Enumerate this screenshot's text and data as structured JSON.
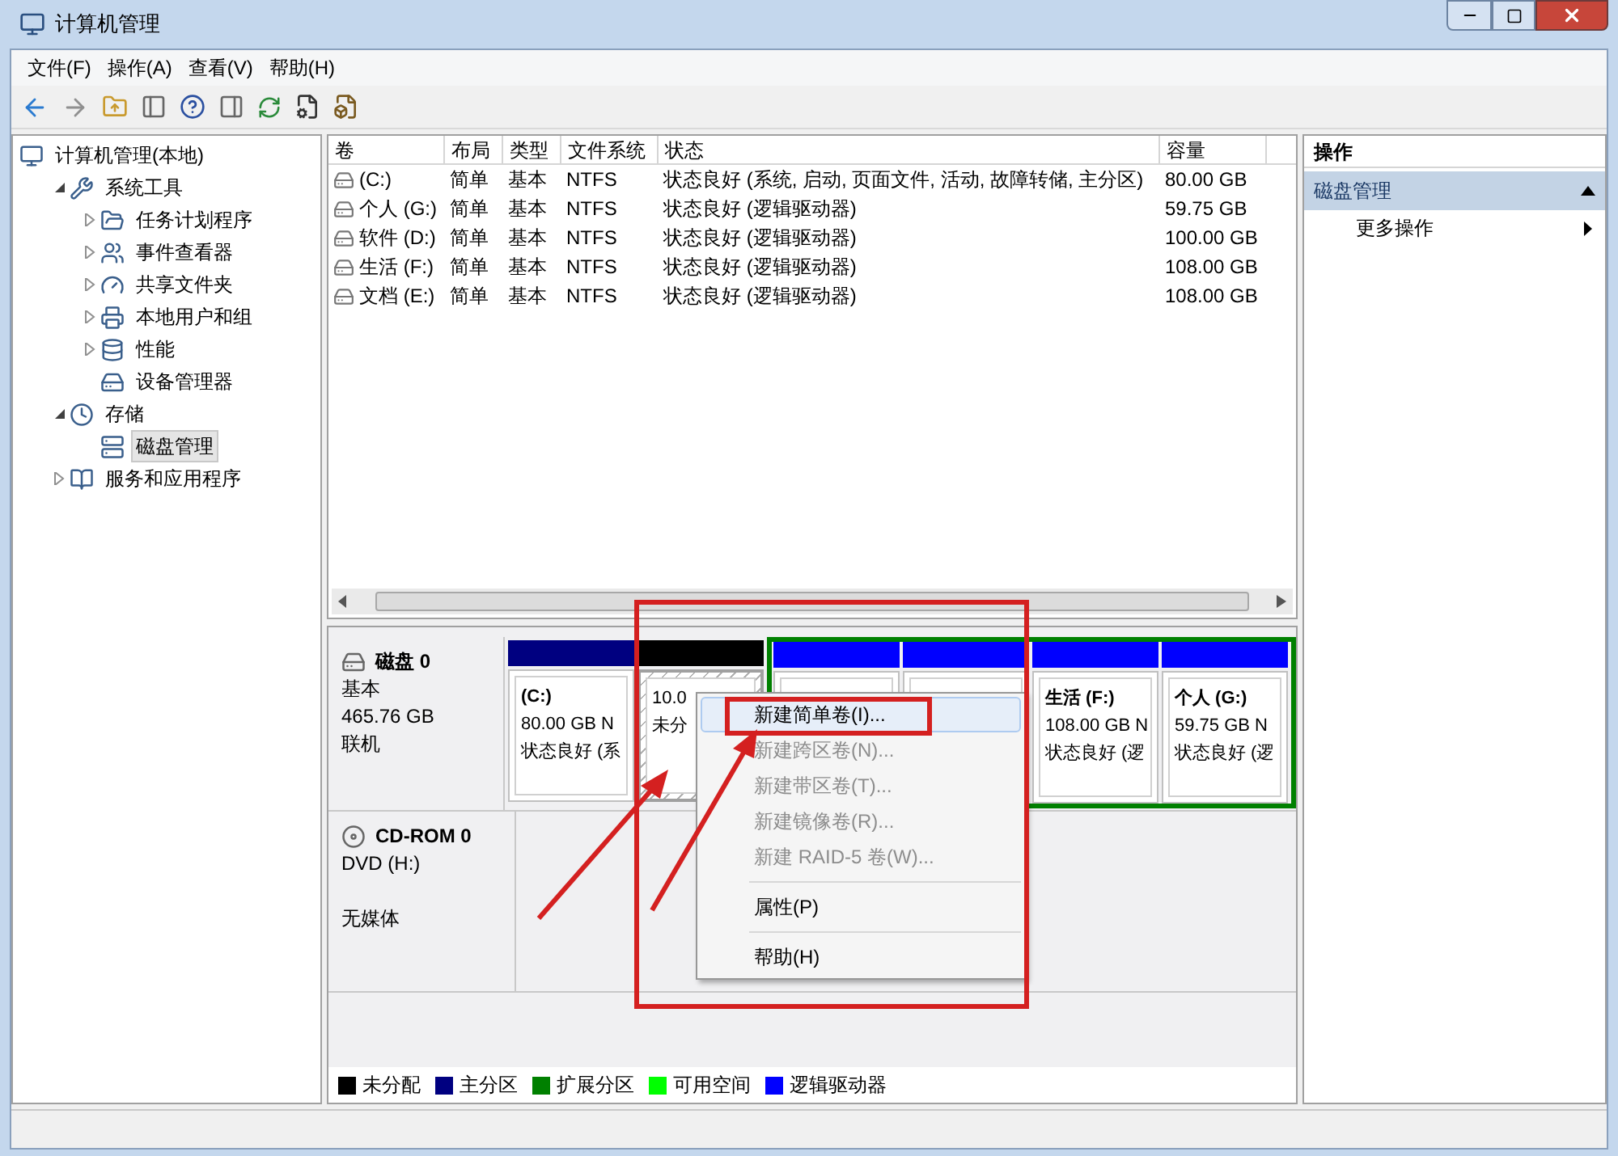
{
  "window": {
    "title": "计算机管理"
  },
  "menu_bar": [
    "文件(F)",
    "操作(A)",
    "查看(V)",
    "帮助(H)"
  ],
  "tree": [
    {
      "label": "计算机管理(本地)",
      "selected": false,
      "children": [
        {
          "label": "系统工具",
          "selected": false,
          "expanded": true,
          "children": [
            {
              "label": "任务计划程序",
              "selected": false,
              "expanded": false
            },
            {
              "label": "事件查看器",
              "selected": false,
              "expanded": false
            },
            {
              "label": "共享文件夹",
              "selected": false,
              "expanded": false
            },
            {
              "label": "本地用户和组",
              "selected": false,
              "expanded": false
            },
            {
              "label": "性能",
              "selected": false,
              "expanded": false
            },
            {
              "label": "设备管理器",
              "selected": false
            }
          ]
        },
        {
          "label": "存储",
          "selected": false,
          "expanded": true,
          "children": [
            {
              "label": "磁盘管理",
              "selected": true
            }
          ]
        },
        {
          "label": "服务和应用程序",
          "selected": false,
          "expanded": false
        }
      ]
    }
  ],
  "volume_table": {
    "columns": [
      "卷",
      "布局",
      "类型",
      "文件系统",
      "状态",
      "容量"
    ],
    "rows": [
      {
        "cells": [
          "(C:)",
          "简单",
          "基本",
          "NTFS",
          "状态良好 (系统, 启动, 页面文件, 活动, 故障转储, 主分区)",
          "80.00 GB"
        ]
      },
      {
        "cells": [
          "个人 (G:)",
          "简单",
          "基本",
          "NTFS",
          "状态良好 (逻辑驱动器)",
          "59.75 GB"
        ]
      },
      {
        "cells": [
          "软件 (D:)",
          "简单",
          "基本",
          "NTFS",
          "状态良好 (逻辑驱动器)",
          "100.00 GB"
        ]
      },
      {
        "cells": [
          "生活 (F:)",
          "简单",
          "基本",
          "NTFS",
          "状态良好 (逻辑驱动器)",
          "108.00 GB"
        ]
      },
      {
        "cells": [
          "文档 (E:)",
          "简单",
          "基本",
          "NTFS",
          "状态良好 (逻辑驱动器)",
          "108.00 GB"
        ]
      }
    ]
  },
  "disks": [
    {
      "kind": "disk",
      "name": "磁盘 0",
      "lines": [
        "基本",
        "465.76 GB",
        "联机"
      ],
      "partitions": [
        {
          "kind": "primary",
          "lines": [
            "(C:)",
            "80.00 GB N",
            "状态良好 (系"
          ]
        },
        {
          "kind": "unallocated",
          "lines": [
            "10.0",
            "未分"
          ]
        },
        {
          "kind": "extended",
          "children": [
            {
              "kind": "logical"
            },
            {
              "kind": "logical"
            },
            {
              "kind": "logical",
              "lines": [
                "生活  (F:)",
                "108.00 GB N",
                "状态良好 (逻"
              ]
            },
            {
              "kind": "logical",
              "lines": [
                "个人  (G:)",
                "59.75 GB N",
                "状态良好 (逻"
              ]
            }
          ]
        }
      ]
    },
    {
      "kind": "cdrom",
      "name": "CD-ROM 0",
      "lines": [
        "DVD (H:)",
        "无媒体"
      ]
    }
  ],
  "legend": [
    {
      "label": "未分配",
      "color": "#000000"
    },
    {
      "label": "主分区",
      "color": "#000080"
    },
    {
      "label": "扩展分区",
      "color": "#008000"
    },
    {
      "label": "可用空间",
      "color": "#00ff00"
    },
    {
      "label": "逻辑驱动器",
      "color": "#0000ff"
    }
  ],
  "actions": {
    "title": "操作",
    "section": {
      "label": "磁盘管理",
      "expanded": true
    },
    "items": [
      {
        "label": "更多操作"
      }
    ]
  },
  "context_menu": [
    {
      "kind": "item",
      "label": "新建简单卷(I)...",
      "disabled": false,
      "selected": true
    },
    {
      "kind": "item",
      "label": "新建跨区卷(N)...",
      "disabled": true,
      "selected": false
    },
    {
      "kind": "item",
      "label": "新建带区卷(T)...",
      "disabled": true,
      "selected": false
    },
    {
      "kind": "item",
      "label": "新建镜像卷(R)...",
      "disabled": true,
      "selected": false
    },
    {
      "kind": "item",
      "label": "新建 RAID-5 卷(W)...",
      "disabled": true,
      "selected": false
    },
    {
      "kind": "separator"
    },
    {
      "kind": "item",
      "label": "属性(P)",
      "disabled": false,
      "selected": false
    },
    {
      "kind": "separator"
    },
    {
      "kind": "item",
      "label": "帮助(H)",
      "disabled": false,
      "selected": false
    }
  ]
}
